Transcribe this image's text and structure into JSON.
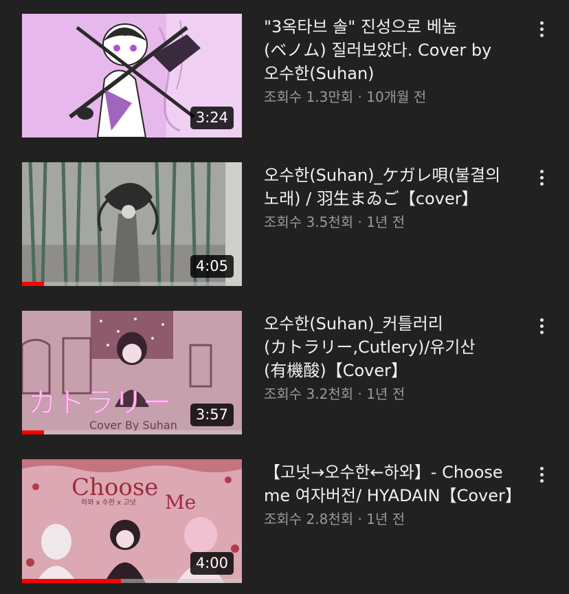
{
  "videos": [
    {
      "title": "\"3옥타브 솔\" 진성으로 베놈(ベノム) 질러보았다. Cover by 오수한(Suhan)",
      "stats": "조회수 1.3만회 · 10개월 전",
      "duration": "3:24",
      "progress": 0,
      "thumb_bg": "#e6b5ea"
    },
    {
      "title": "오수한(Suhan)_ケガレ唄(불결의 노래) / 羽生まゐご【cover】",
      "stats": "조회수 3.5천회 · 1년 전",
      "duration": "4:05",
      "progress": 0.1,
      "thumb_bg": "#9a9c98"
    },
    {
      "title": "오수한(Suhan)_커틀러리(カトラリー,Cutlery)/유기산(有機酸)【Cover】",
      "stats": "조회수 3.2천회 · 1년 전",
      "duration": "3:57",
      "progress": 0.1,
      "thumb_bg": "#c9a0ad",
      "thumb_text": "カトラリー",
      "thumb_subtext": "Cover By Suhan"
    },
    {
      "title": "【고넛→오수한←하와】- Choose me 여자버전/ HYADAIN【Cover】",
      "stats": "조회수 2.8천회 · 1년 전",
      "duration": "4:00",
      "progress": 0.45,
      "thumb_bg": "#d9a7b2",
      "thumb_text": "Choose",
      "thumb_text2": "Me",
      "thumb_subtext": "하와 x 수한 x 고넛"
    }
  ],
  "colors": {
    "background": "#212121",
    "progress": "#ff0000",
    "title": "#f1f1f1",
    "meta": "#9a9a9a"
  },
  "icons": {
    "more": "more-vert-icon"
  }
}
